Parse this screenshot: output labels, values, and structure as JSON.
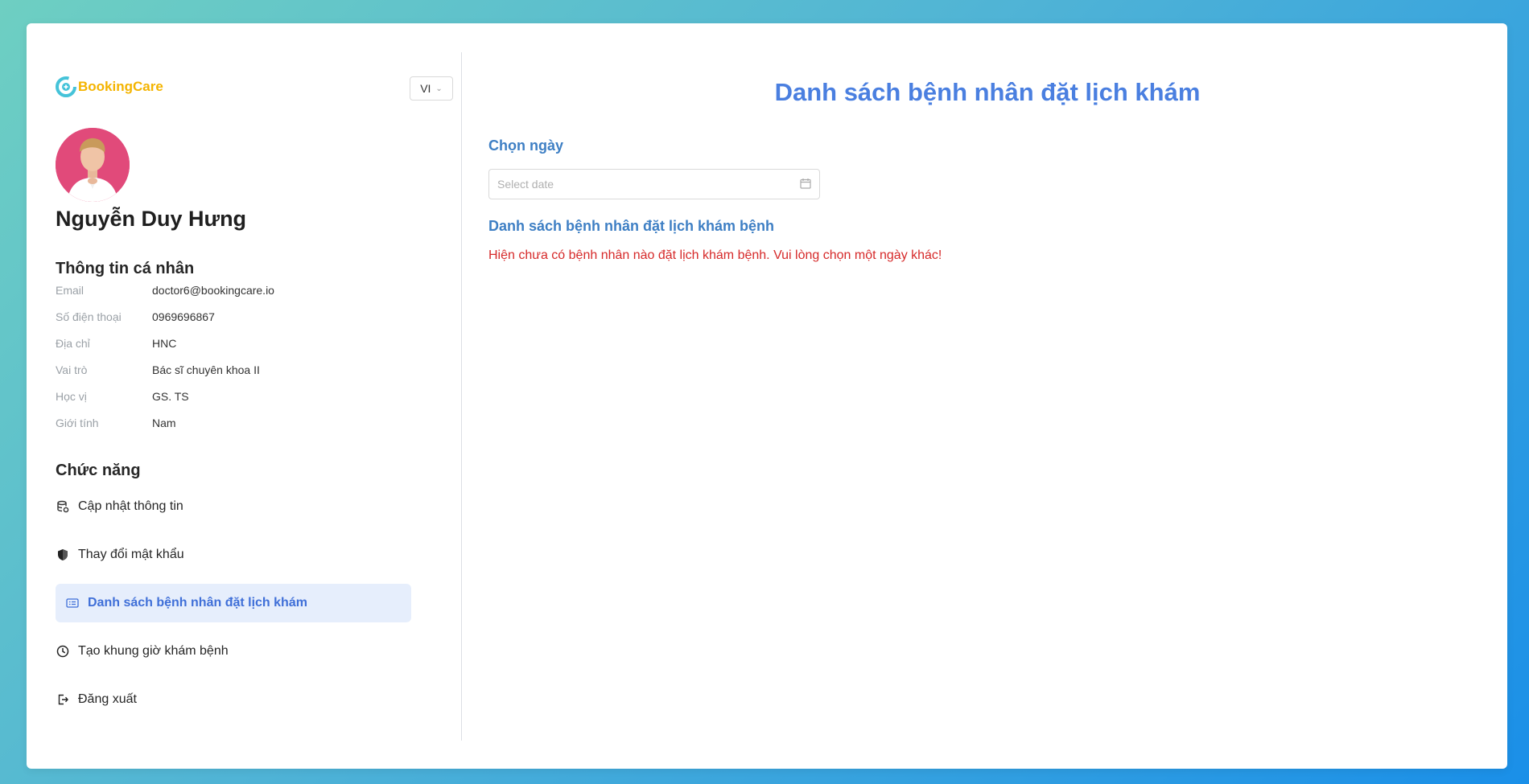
{
  "brand": {
    "name": "BookingCare"
  },
  "lang": {
    "value": "VI"
  },
  "profile": {
    "name": "Nguyễn Duy Hưng"
  },
  "info": {
    "title": "Thông tin cá nhân",
    "rows": [
      {
        "label": "Email",
        "value": "doctor6@bookingcare.io"
      },
      {
        "label": "Số điện thoại",
        "value": "0969696867"
      },
      {
        "label": "Địa chỉ",
        "value": "HNC"
      },
      {
        "label": "Vai trò",
        "value": "Bác sĩ chuyên khoa II"
      },
      {
        "label": "Học vị",
        "value": "GS. TS"
      },
      {
        "label": "Giới tính",
        "value": "Nam"
      }
    ]
  },
  "functions": {
    "title": "Chức năng",
    "items": [
      {
        "label": "Cập nhật thông tin",
        "icon": "database-gear-icon"
      },
      {
        "label": "Thay đổi mật khẩu",
        "icon": "shield-icon"
      },
      {
        "label": "Danh sách bệnh nhân đặt lịch khám",
        "icon": "list-card-icon",
        "active": true
      },
      {
        "label": "Tạo khung giờ khám bệnh",
        "icon": "clock-icon"
      },
      {
        "label": "Đăng xuất",
        "icon": "logout-icon"
      }
    ]
  },
  "main": {
    "title": "Danh sách bệnh nhân đặt lịch khám",
    "date_label": "Chọn ngày",
    "date_placeholder": "Select date",
    "list_title": "Danh sách bệnh nhân đặt lịch khám bệnh",
    "empty_message": "Hiện chưa có bệnh nhân nào đặt lịch khám bệnh. Vui lòng chọn một ngày khác!"
  },
  "colors": {
    "accent": "#4a7fe0",
    "section_blue": "#3e7fc4",
    "error": "#d62a2a",
    "active_bg": "#e6eefc",
    "brand_yellow": "#f4b400"
  }
}
